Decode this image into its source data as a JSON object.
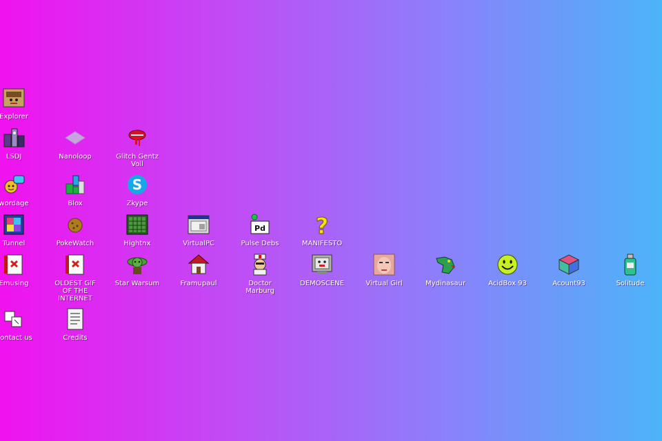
{
  "desktop": {
    "background": {
      "left": "#f112ef",
      "right": "#4cb4f9"
    },
    "icons": [
      {
        "label": "Explorer",
        "icon": "explorer-icon"
      },
      {
        "label": "LSDJ",
        "icon": "lsdj-icon"
      },
      {
        "label": "Nanoloop",
        "icon": "nanoloop-icon"
      },
      {
        "label": "Glitch Gentz\nVoll",
        "icon": "lips-icon"
      },
      {
        "label": "wordage",
        "icon": "chat-icon"
      },
      {
        "label": "Blox",
        "icon": "blocks-icon"
      },
      {
        "label": "Zkype",
        "icon": "zkype-icon"
      },
      {
        "label": "Tunnel",
        "icon": "tunnel-icon"
      },
      {
        "label": "PokeWatch",
        "icon": "cookie-icon"
      },
      {
        "label": "Hightnx",
        "icon": "grid-icon"
      },
      {
        "label": "VirtualPC",
        "icon": "window-icon"
      },
      {
        "label": "Pulse Debs",
        "icon": "pd-icon"
      },
      {
        "label": "MANIFESTO",
        "icon": "question-icon"
      },
      {
        "label": "Emusing",
        "icon": "document-icon"
      },
      {
        "label": "OLDEST GIF\nOF THE\nINTERNET",
        "icon": "gif-document-icon"
      },
      {
        "label": "Star Warsum",
        "icon": "yoda-icon"
      },
      {
        "label": "Framupaul",
        "icon": "house-icon"
      },
      {
        "label": "Doctor\nMarburg",
        "icon": "doctor-icon"
      },
      {
        "label": "DEMOSCENE",
        "icon": "monitor-face-icon"
      },
      {
        "label": "Virtual Girl",
        "icon": "face-icon"
      },
      {
        "label": "Mydinasaur",
        "icon": "dinosaur-icon"
      },
      {
        "label": "AcidBox 93",
        "icon": "smiley-icon"
      },
      {
        "label": "Acount93",
        "icon": "cube-icon"
      },
      {
        "label": "Solitude",
        "icon": "bottle-icon"
      },
      {
        "label": "Contact us",
        "icon": "contact-icon"
      },
      {
        "label": "Credits",
        "icon": "credits-icon"
      }
    ]
  }
}
